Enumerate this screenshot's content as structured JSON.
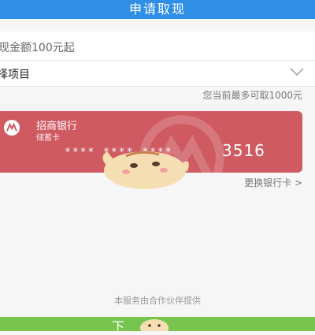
{
  "header": {
    "title": "申请取现"
  },
  "form": {
    "amount_hint": "现金额100元起",
    "project_label": "择项目",
    "max_hint": "您当前最多可取1000元"
  },
  "card": {
    "bank_name": "招商银行",
    "card_type": "储蓄卡",
    "masked_number": "**** **** ****",
    "last_digits": "3516",
    "brand_color": "#cf5a62"
  },
  "change_card_label": "更换银行卡 >",
  "footer": {
    "provider_note": "本服务由合作伙伴提供",
    "next_label": "下"
  },
  "colors": {
    "header": "#2f8fe6",
    "button": "#77c44f"
  }
}
